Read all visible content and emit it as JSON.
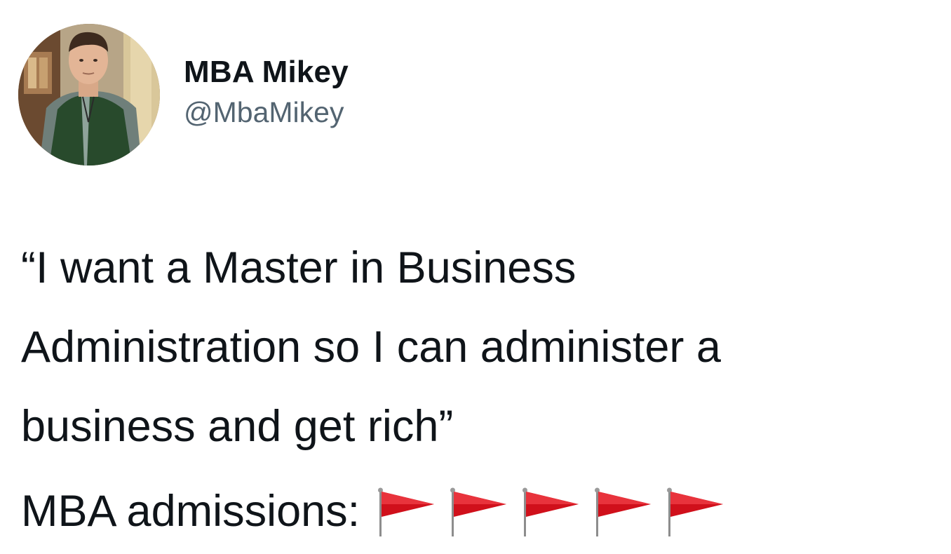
{
  "user": {
    "display_name": "MBA Mikey",
    "handle": "@MbaMikey",
    "avatar": "profile-photo"
  },
  "tweet": {
    "lines": [
      "“I want a Master in Business",
      "Administration so I can administer a",
      "business and get rich”"
    ],
    "admissions_label": "MBA admissions:",
    "flags": [
      "red-flag-icon",
      "red-flag-icon",
      "red-flag-icon",
      "red-flag-icon",
      "red-flag-icon"
    ],
    "flag_color": "#d0101b"
  },
  "colors": {
    "text": "#0f1419",
    "secondary": "#536471",
    "background": "#ffffff"
  }
}
